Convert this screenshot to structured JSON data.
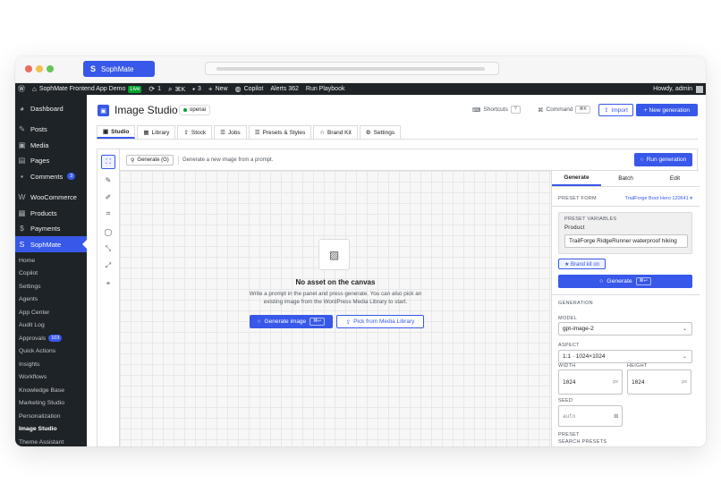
{
  "browser": {
    "tab_label": "SophMate"
  },
  "adminbar": {
    "site": "SophMate Frontend App Demo",
    "live": "Live",
    "updates": "1",
    "shortcut": "⌘K",
    "comments": "3",
    "new": "New",
    "copilot": "Copilot",
    "alerts": "Alerts 362",
    "playbook": "Run Playbook",
    "howdy": "Howdy, admin"
  },
  "sidebar": {
    "items": [
      {
        "label": "Dashboard",
        "icon": "dashboard-icon"
      },
      {
        "label": "Posts",
        "icon": "pin-icon"
      },
      {
        "label": "Media",
        "icon": "media-icon"
      },
      {
        "label": "Pages",
        "icon": "pages-icon"
      },
      {
        "label": "Comments",
        "icon": "comment-icon",
        "badge": "3"
      },
      {
        "label": "WooCommerce",
        "icon": "woo-icon"
      },
      {
        "label": "Products",
        "icon": "products-icon"
      },
      {
        "label": "Payments",
        "icon": "payments-icon"
      },
      {
        "label": "SophMate",
        "icon": "sophmate-icon"
      }
    ],
    "sub": [
      {
        "label": "Home"
      },
      {
        "label": "Copilot"
      },
      {
        "label": "Settings"
      },
      {
        "label": "Agents"
      },
      {
        "label": "App Center"
      },
      {
        "label": "Audit Log"
      },
      {
        "label": "Approvals",
        "badge": "103"
      },
      {
        "label": "Quick Actions"
      },
      {
        "label": "Insights"
      },
      {
        "label": "Workflows"
      },
      {
        "label": "Knowledge Base"
      },
      {
        "label": "Marketing Studio"
      },
      {
        "label": "Personalization"
      },
      {
        "label": "Image Studio"
      },
      {
        "label": "Theme Assistant"
      }
    ]
  },
  "header": {
    "title": "Image Studio",
    "model": "openai",
    "shortcuts": "Shortcuts",
    "shortcuts_key": "?",
    "command": "Command",
    "command_key": "⌘K",
    "import": "Import",
    "new_generation": "+ New generation"
  },
  "tabs": [
    {
      "label": "Studio",
      "icon": "studio-icon"
    },
    {
      "label": "Library",
      "icon": "library-icon"
    },
    {
      "label": "Stock",
      "icon": "stock-icon"
    },
    {
      "label": "Jobs",
      "icon": "jobs-icon"
    },
    {
      "label": "Presets & Styles",
      "icon": "presets-icon"
    },
    {
      "label": "Brand Kit",
      "icon": "star-icon"
    },
    {
      "label": "Settings",
      "icon": "gear-icon"
    }
  ],
  "toolbar": {
    "generate": "Generate (G)",
    "hint": "Generate a new image from a prompt.",
    "run": "Run generation"
  },
  "canvas": {
    "empty_title": "No asset on the canvas",
    "empty_desc": "Write a prompt in the panel and press generate. You can also pick an existing image from the WordPress Media Library to start.",
    "generate_btn": "Generate image",
    "generate_key": "⌘↩",
    "pick_btn": "Pick from Media Library"
  },
  "panel": {
    "tabs": [
      "Generate",
      "Batch",
      "Edit"
    ],
    "preset_form_label": "PRESET FORM",
    "preset_form_value": "TrailForge Boot Hero 120641 ▾",
    "preset_vars_label": "PRESET VARIABLES",
    "product_label": "Product",
    "product_value": "TrailForge RidgeRunner waterproof hiking",
    "brand_kit": "★ Brand kit on",
    "generate_btn": "Generate",
    "generate_key": "⌘↩",
    "generation_label": "GENERATION",
    "model_label": "MODEL",
    "model_value": "gpt-image-2",
    "aspect_label": "ASPECT",
    "aspect_value": "1:1 · 1024×1024",
    "width_label": "WIDTH",
    "width_value": "1024",
    "height_label": "HEIGHT",
    "height_value": "1024",
    "unit": "px",
    "seed_label": "SEED",
    "seed_placeholder": "auto",
    "preset_label": "PRESET",
    "search_presets": "SEARCH PRESETS"
  },
  "colors": {
    "accent": "#3858e9",
    "sidebar": "#1d2327"
  }
}
